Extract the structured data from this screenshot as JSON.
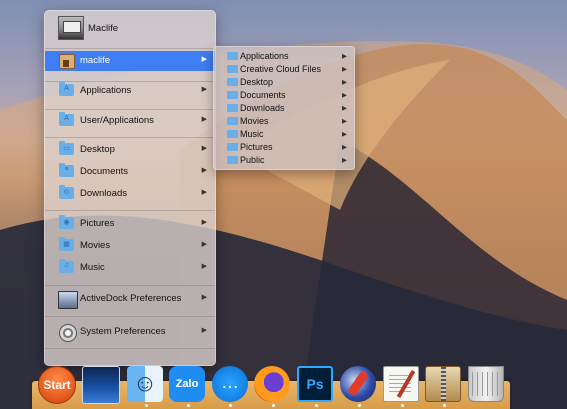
{
  "menu": {
    "user_name": "Maclife",
    "home_label": "maclife",
    "items": [
      {
        "label": "Applications",
        "icon": "applications-folder-icon"
      },
      {
        "label": "User/Applications",
        "icon": "applications-folder-icon"
      },
      {
        "label": "Desktop",
        "icon": "desktop-folder-icon"
      },
      {
        "label": "Documents",
        "icon": "documents-folder-icon"
      },
      {
        "label": "Downloads",
        "icon": "downloads-folder-icon"
      },
      {
        "label": "Pictures",
        "icon": "pictures-folder-icon"
      },
      {
        "label": "Movies",
        "icon": "movies-folder-icon"
      },
      {
        "label": "Music",
        "icon": "music-folder-icon"
      },
      {
        "label": "ActiveDock Preferences",
        "icon": "activedock-preferences-icon"
      },
      {
        "label": "System Preferences",
        "icon": "system-preferences-icon"
      }
    ],
    "arrow": "▶"
  },
  "submenu": {
    "items": [
      "Applications",
      "Creative Cloud Files",
      "Desktop",
      "Documents",
      "Downloads",
      "Movies",
      "Music",
      "Pictures",
      "Public"
    ]
  },
  "dock": {
    "start_label": "Start",
    "zalo_label": "Zalo",
    "ps_label": "Ps",
    "messenger_glyph": "…",
    "background_color": "#e0a755"
  },
  "colors": {
    "selection": "#3f7ef2",
    "folder": "#6aaee8"
  }
}
